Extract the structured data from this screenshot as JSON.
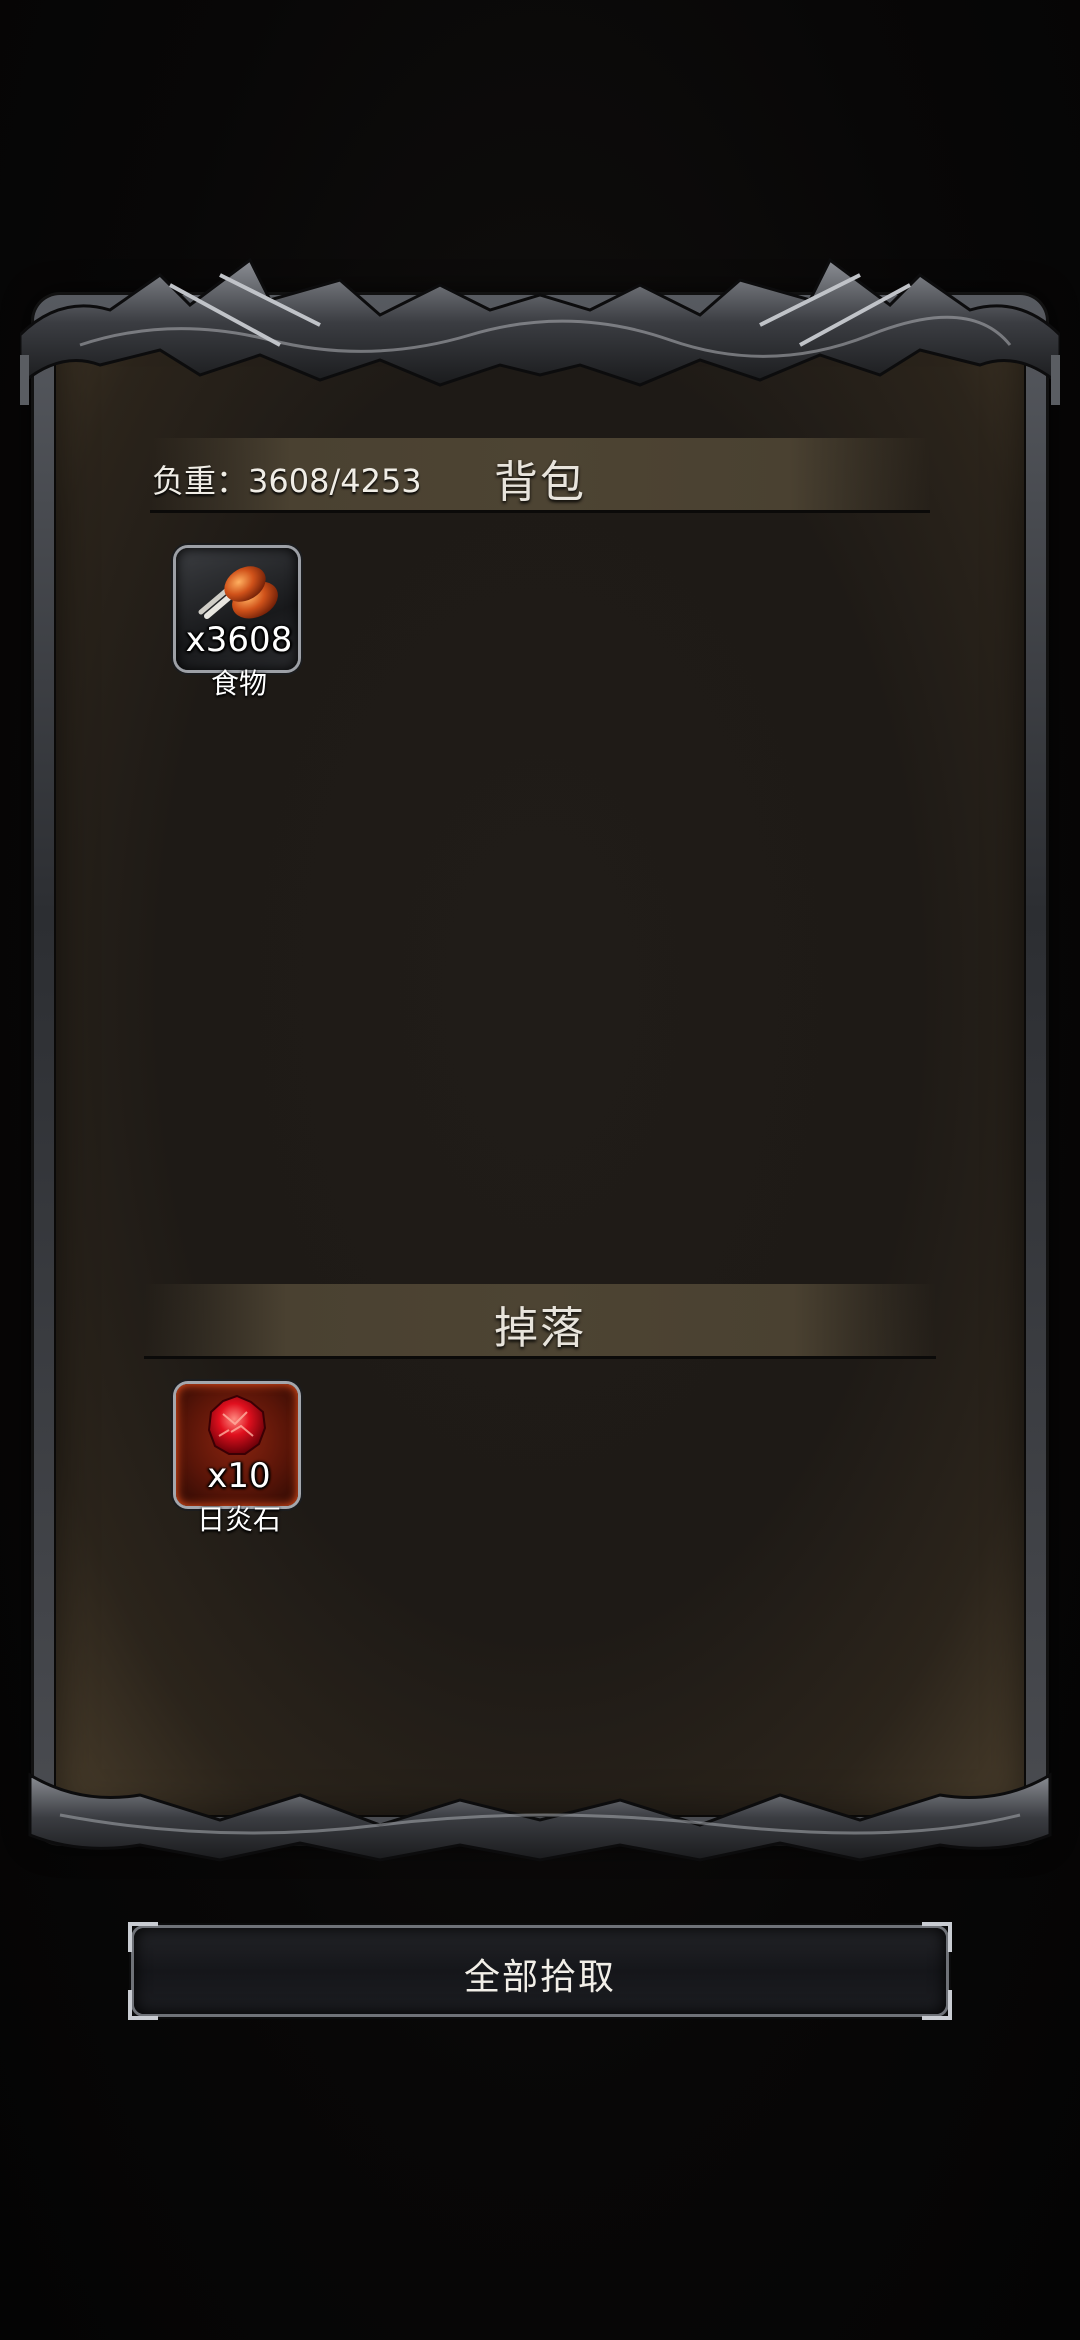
{
  "backpack": {
    "title": "背包",
    "weight_text": "负重：3608/4253",
    "items": [
      {
        "name": "食物",
        "count": "x3608",
        "icon": "chicken-leg-icon"
      }
    ]
  },
  "drops": {
    "title": "掉落",
    "items": [
      {
        "name": "日炎石",
        "count": "x10",
        "icon": "red-gem-icon"
      }
    ]
  },
  "actions": {
    "pick_all_label": "全部拾取"
  },
  "colors": {
    "panel": "#1e1a16",
    "header_band": "#4d4433",
    "frame_metal": "#575a60",
    "text": "#e8e4dc"
  }
}
